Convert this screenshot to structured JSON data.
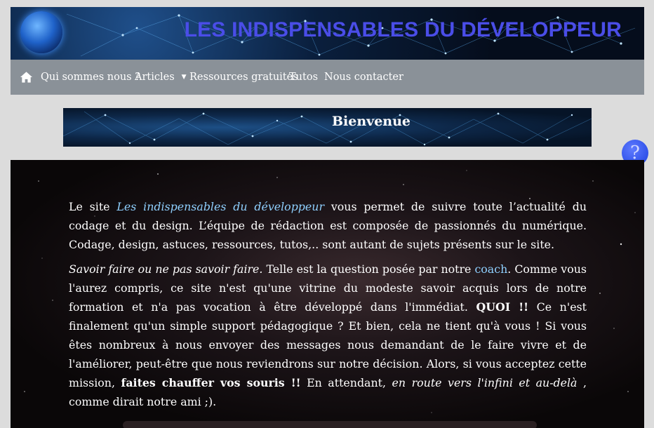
{
  "header": {
    "site_title": "LES INDISPENSABLES DU DÉVELOPPEUR",
    "logo_icon": "globe-icon"
  },
  "nav": {
    "home_icon": "home-icon",
    "items": [
      {
        "label": "Qui sommes nous ?"
      },
      {
        "label": "Articles",
        "has_dropdown": true
      },
      {
        "label": "Ressources gratuites"
      },
      {
        "label": "Tutos"
      },
      {
        "label": "Nous contacter"
      }
    ]
  },
  "banner": {
    "title": "Bienvenue"
  },
  "help_button": {
    "label": "?",
    "icon": "help-icon"
  },
  "content": {
    "p1": {
      "a": "Le site ",
      "link": "Les indispensables du développeur",
      "b": " vous permet de suivre toute l’actualité du codage et du design. L’équipe de rédaction est composée de passionnés du numérique. Codage, design, astuces, ressources, tutos,.. sont autant de sujets présents sur le site."
    },
    "p2": {
      "italic": "Savoir faire ou ne pas savoir faire.",
      "a": " Telle est la question posée par notre ",
      "link": "coach",
      "b": ". Comme vous l'aurez compris, ce site n'est qu'une vitrine du modeste savoir acquis lors de notre formation et n'a pas vocation à être développé dans l'immédiat. ",
      "bold1": "QUOI !!",
      "c": " Ce n'est finalement qu'un simple support pédagogique ? Et bien, cela ne tient qu'à vous ! Si vous êtes nombreux à nous envoyer des messages nous demandant de le faire vivre et de l'améliorer, peut-être que nous reviendrons sur notre décision. Alors, si vous acceptez cette mission, ",
      "bold2": "faites chauffer vos souris !!",
      "d": " En attendant, ",
      "italic2": "en route vers l'infini et au-delà",
      "e": " , comme dirait notre ami ;)."
    }
  },
  "colors": {
    "title": "#4a4de8",
    "nav_bg": "#8a9198",
    "page_bg": "#dcdcdc",
    "link": "#8fd0ff",
    "help_button": "#1b3fe0"
  }
}
